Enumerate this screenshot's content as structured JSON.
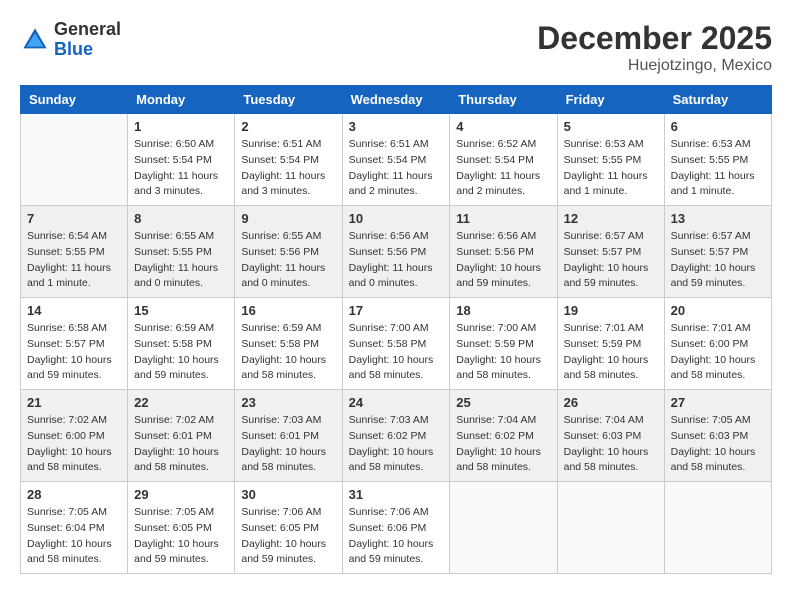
{
  "header": {
    "logo_general": "General",
    "logo_blue": "Blue",
    "month_title": "December 2025",
    "location": "Huejotzingo, Mexico"
  },
  "weekdays": [
    "Sunday",
    "Monday",
    "Tuesday",
    "Wednesday",
    "Thursday",
    "Friday",
    "Saturday"
  ],
  "weeks": [
    [
      {
        "day": "",
        "sunrise": "",
        "sunset": "",
        "daylight": ""
      },
      {
        "day": "1",
        "sunrise": "Sunrise: 6:50 AM",
        "sunset": "Sunset: 5:54 PM",
        "daylight": "Daylight: 11 hours and 3 minutes."
      },
      {
        "day": "2",
        "sunrise": "Sunrise: 6:51 AM",
        "sunset": "Sunset: 5:54 PM",
        "daylight": "Daylight: 11 hours and 3 minutes."
      },
      {
        "day": "3",
        "sunrise": "Sunrise: 6:51 AM",
        "sunset": "Sunset: 5:54 PM",
        "daylight": "Daylight: 11 hours and 2 minutes."
      },
      {
        "day": "4",
        "sunrise": "Sunrise: 6:52 AM",
        "sunset": "Sunset: 5:54 PM",
        "daylight": "Daylight: 11 hours and 2 minutes."
      },
      {
        "day": "5",
        "sunrise": "Sunrise: 6:53 AM",
        "sunset": "Sunset: 5:55 PM",
        "daylight": "Daylight: 11 hours and 1 minute."
      },
      {
        "day": "6",
        "sunrise": "Sunrise: 6:53 AM",
        "sunset": "Sunset: 5:55 PM",
        "daylight": "Daylight: 11 hours and 1 minute."
      }
    ],
    [
      {
        "day": "7",
        "sunrise": "Sunrise: 6:54 AM",
        "sunset": "Sunset: 5:55 PM",
        "daylight": "Daylight: 11 hours and 1 minute."
      },
      {
        "day": "8",
        "sunrise": "Sunrise: 6:55 AM",
        "sunset": "Sunset: 5:55 PM",
        "daylight": "Daylight: 11 hours and 0 minutes."
      },
      {
        "day": "9",
        "sunrise": "Sunrise: 6:55 AM",
        "sunset": "Sunset: 5:56 PM",
        "daylight": "Daylight: 11 hours and 0 minutes."
      },
      {
        "day": "10",
        "sunrise": "Sunrise: 6:56 AM",
        "sunset": "Sunset: 5:56 PM",
        "daylight": "Daylight: 11 hours and 0 minutes."
      },
      {
        "day": "11",
        "sunrise": "Sunrise: 6:56 AM",
        "sunset": "Sunset: 5:56 PM",
        "daylight": "Daylight: 10 hours and 59 minutes."
      },
      {
        "day": "12",
        "sunrise": "Sunrise: 6:57 AM",
        "sunset": "Sunset: 5:57 PM",
        "daylight": "Daylight: 10 hours and 59 minutes."
      },
      {
        "day": "13",
        "sunrise": "Sunrise: 6:57 AM",
        "sunset": "Sunset: 5:57 PM",
        "daylight": "Daylight: 10 hours and 59 minutes."
      }
    ],
    [
      {
        "day": "14",
        "sunrise": "Sunrise: 6:58 AM",
        "sunset": "Sunset: 5:57 PM",
        "daylight": "Daylight: 10 hours and 59 minutes."
      },
      {
        "day": "15",
        "sunrise": "Sunrise: 6:59 AM",
        "sunset": "Sunset: 5:58 PM",
        "daylight": "Daylight: 10 hours and 59 minutes."
      },
      {
        "day": "16",
        "sunrise": "Sunrise: 6:59 AM",
        "sunset": "Sunset: 5:58 PM",
        "daylight": "Daylight: 10 hours and 58 minutes."
      },
      {
        "day": "17",
        "sunrise": "Sunrise: 7:00 AM",
        "sunset": "Sunset: 5:58 PM",
        "daylight": "Daylight: 10 hours and 58 minutes."
      },
      {
        "day": "18",
        "sunrise": "Sunrise: 7:00 AM",
        "sunset": "Sunset: 5:59 PM",
        "daylight": "Daylight: 10 hours and 58 minutes."
      },
      {
        "day": "19",
        "sunrise": "Sunrise: 7:01 AM",
        "sunset": "Sunset: 5:59 PM",
        "daylight": "Daylight: 10 hours and 58 minutes."
      },
      {
        "day": "20",
        "sunrise": "Sunrise: 7:01 AM",
        "sunset": "Sunset: 6:00 PM",
        "daylight": "Daylight: 10 hours and 58 minutes."
      }
    ],
    [
      {
        "day": "21",
        "sunrise": "Sunrise: 7:02 AM",
        "sunset": "Sunset: 6:00 PM",
        "daylight": "Daylight: 10 hours and 58 minutes."
      },
      {
        "day": "22",
        "sunrise": "Sunrise: 7:02 AM",
        "sunset": "Sunset: 6:01 PM",
        "daylight": "Daylight: 10 hours and 58 minutes."
      },
      {
        "day": "23",
        "sunrise": "Sunrise: 7:03 AM",
        "sunset": "Sunset: 6:01 PM",
        "daylight": "Daylight: 10 hours and 58 minutes."
      },
      {
        "day": "24",
        "sunrise": "Sunrise: 7:03 AM",
        "sunset": "Sunset: 6:02 PM",
        "daylight": "Daylight: 10 hours and 58 minutes."
      },
      {
        "day": "25",
        "sunrise": "Sunrise: 7:04 AM",
        "sunset": "Sunset: 6:02 PM",
        "daylight": "Daylight: 10 hours and 58 minutes."
      },
      {
        "day": "26",
        "sunrise": "Sunrise: 7:04 AM",
        "sunset": "Sunset: 6:03 PM",
        "daylight": "Daylight: 10 hours and 58 minutes."
      },
      {
        "day": "27",
        "sunrise": "Sunrise: 7:05 AM",
        "sunset": "Sunset: 6:03 PM",
        "daylight": "Daylight: 10 hours and 58 minutes."
      }
    ],
    [
      {
        "day": "28",
        "sunrise": "Sunrise: 7:05 AM",
        "sunset": "Sunset: 6:04 PM",
        "daylight": "Daylight: 10 hours and 58 minutes."
      },
      {
        "day": "29",
        "sunrise": "Sunrise: 7:05 AM",
        "sunset": "Sunset: 6:05 PM",
        "daylight": "Daylight: 10 hours and 59 minutes."
      },
      {
        "day": "30",
        "sunrise": "Sunrise: 7:06 AM",
        "sunset": "Sunset: 6:05 PM",
        "daylight": "Daylight: 10 hours and 59 minutes."
      },
      {
        "day": "31",
        "sunrise": "Sunrise: 7:06 AM",
        "sunset": "Sunset: 6:06 PM",
        "daylight": "Daylight: 10 hours and 59 minutes."
      },
      {
        "day": "",
        "sunrise": "",
        "sunset": "",
        "daylight": ""
      },
      {
        "day": "",
        "sunrise": "",
        "sunset": "",
        "daylight": ""
      },
      {
        "day": "",
        "sunrise": "",
        "sunset": "",
        "daylight": ""
      }
    ]
  ]
}
